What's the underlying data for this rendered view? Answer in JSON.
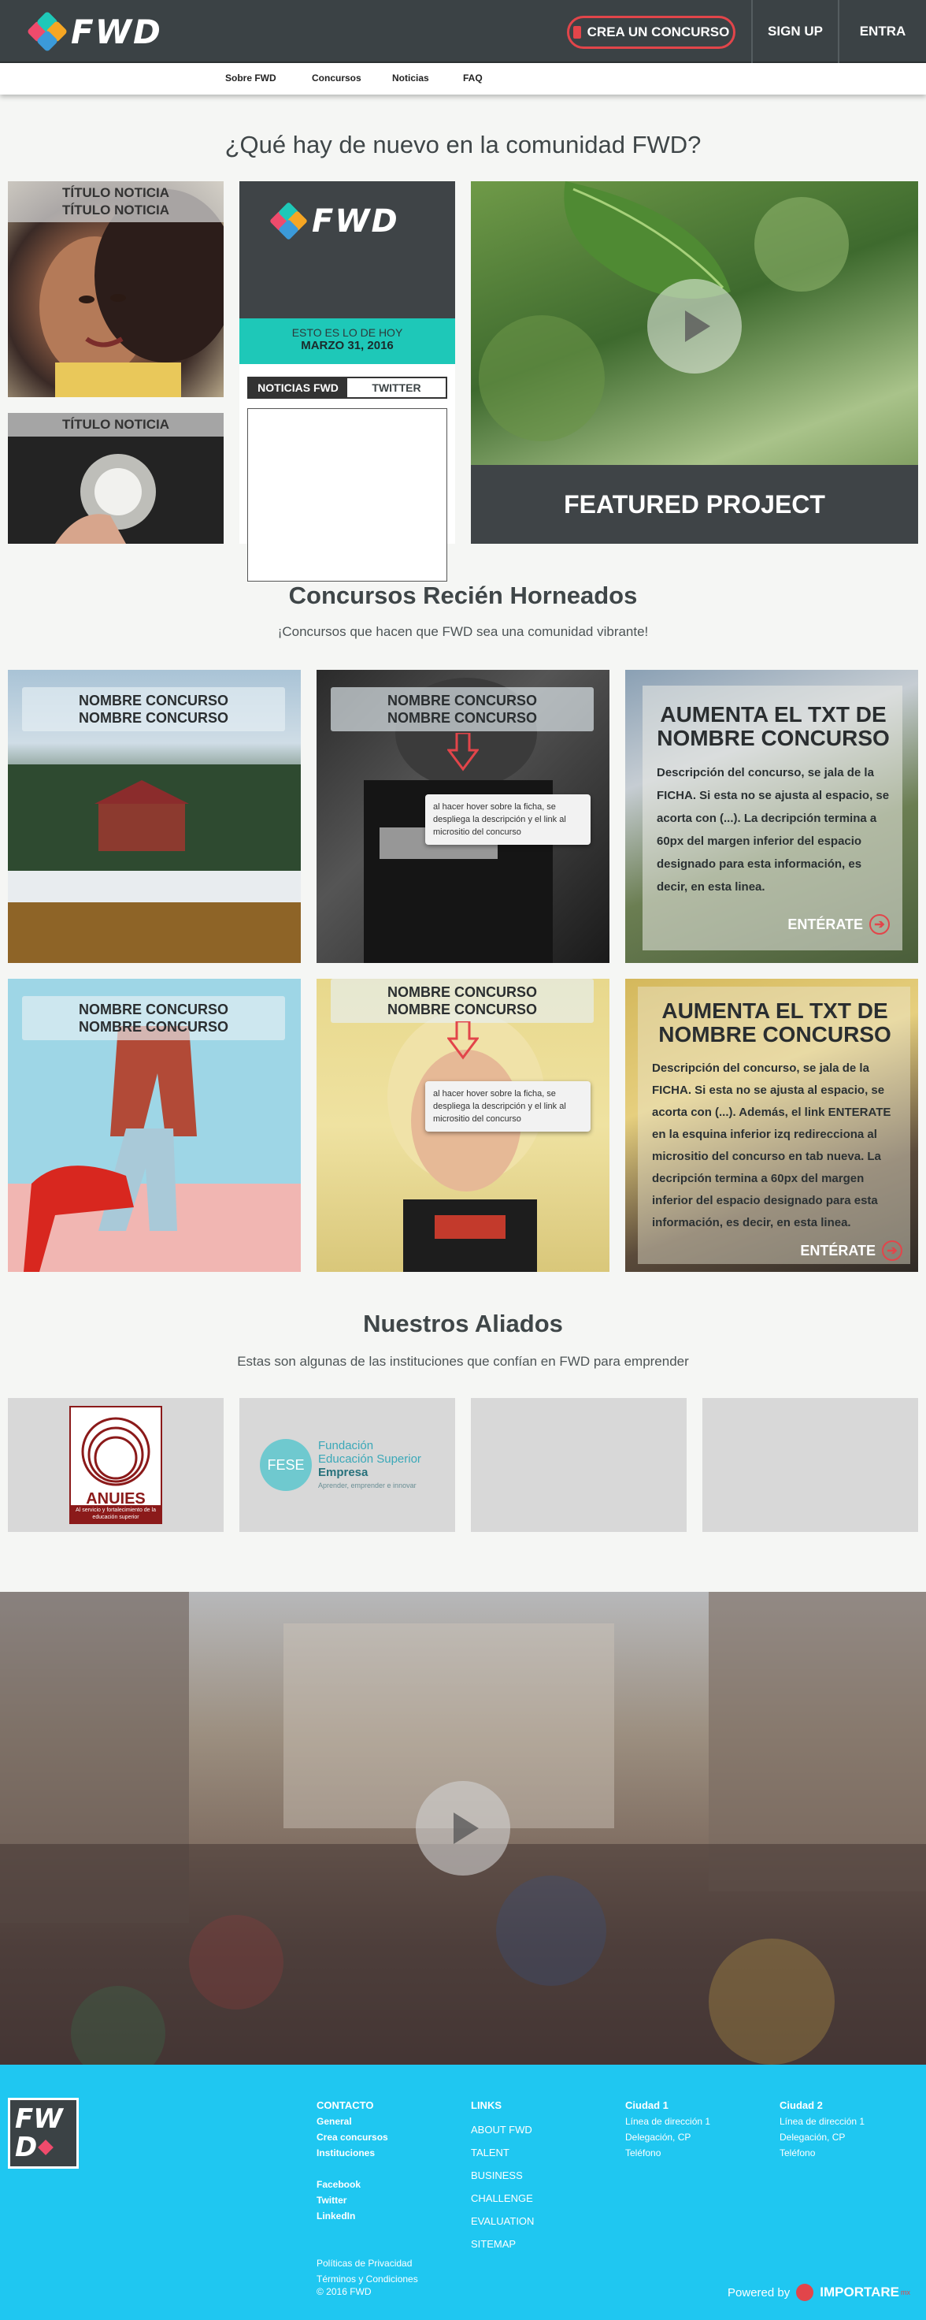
{
  "header": {
    "logo_text": "FWD",
    "create_button": "CREA UN CONCURSO",
    "signup": "SIGN UP",
    "login": "ENTRA",
    "accent": "#e2454a",
    "bg": "#3b4245"
  },
  "subnav": [
    "Sobre FWD",
    "Concursos",
    "Noticias",
    "FAQ"
  ],
  "news": {
    "title": "¿Qué hay de nuevo en la comunidad FWD?",
    "card1_title": "TÍTULO NOTICIA\nTÍTULO NOTICIA",
    "card1_line1": "TÍTULO NOTICIA",
    "card1_line2": "TÍTULO NOTICIA",
    "card2_title": "TÍTULO NOTICIA",
    "panel": {
      "logo_text": "FWD",
      "today": "ESTO ES LO DE HOY",
      "date": "MARZO 31, 2016",
      "tab_news": "NOTICIAS FWD",
      "tab_twitter": "TWITTER"
    },
    "featured": "FEATURED PROJECT"
  },
  "contests": {
    "title": "Concursos Recién Horneados",
    "subtitle": "¡Concursos que hacen que FWD sea una comunidad vibrante!",
    "name_line1": "NOMBRE CONCURSO",
    "name_line2": "NOMBRE CONCURSO",
    "hover_text": "al hacer hover sobre la ficha, se despliega la descripción y el link al micrositio del concurso",
    "expand1_title": "AUMENTA EL TXT DE NOMBRE CONCURSO",
    "expand1_text": "Descripción del concurso, se jala de la FICHA. Si esta no se ajusta al espacio, se acorta con (...). La decripción termina a 60px del margen inferior del espacio designado para esta información, es decir, en esta linea.",
    "expand2_title": "AUMENTA EL TXT DE NOMBRE CONCURSO",
    "expand2_text": "Descripción del concurso, se jala de la FICHA. Si esta no se ajusta al espacio, se acorta con (...). Además, el link ENTERATE en la esquina inferior izq redirecciona al micrositio del concurso en tab nueva. La decripción termina a 60px del margen inferior del espacio designado para esta información, es decir, en esta linea.",
    "enterate": "ENTÉRATE"
  },
  "partners": {
    "title": "Nuestros Aliados",
    "subtitle": "Estas son algunas de las instituciones que confían en FWD para emprender",
    "anuies": "ANUIES",
    "anuies_tag": "Al servicio y fortalecimiento de la educación superior",
    "fese_badge": "FESE",
    "fese_line1": "Fundación",
    "fese_line2": "Educación Superior",
    "fese_line3": "Empresa",
    "fese_line4": "Aprender, emprender e innovar"
  },
  "footer": {
    "logo_top": "FW",
    "logo_bottom": "D",
    "contacto": "CONTACTO",
    "contact_links": [
      "General",
      "Crea concursos",
      "Instituciones"
    ],
    "social": [
      "Facebook",
      "Twitter",
      "LinkedIn"
    ],
    "legal": [
      "Políticas de Privacidad",
      "Términos y Condiciones",
      "© 2016 FWD"
    ],
    "links_title": "LINKS",
    "links": [
      "ABOUT FWD",
      "TALENT",
      "BUSINESS",
      "CHALLENGE",
      "EVALUATION",
      "SITEMAP"
    ],
    "city1": "Ciudad 1",
    "city2": "Ciudad 2",
    "address": [
      "Línea de dirección 1",
      "Delegación, CP",
      "Teléfono"
    ],
    "powered": "Powered by",
    "importare": "IMPORTARE",
    "importare_suffix": "mx",
    "bg": "#1fc7f1"
  }
}
